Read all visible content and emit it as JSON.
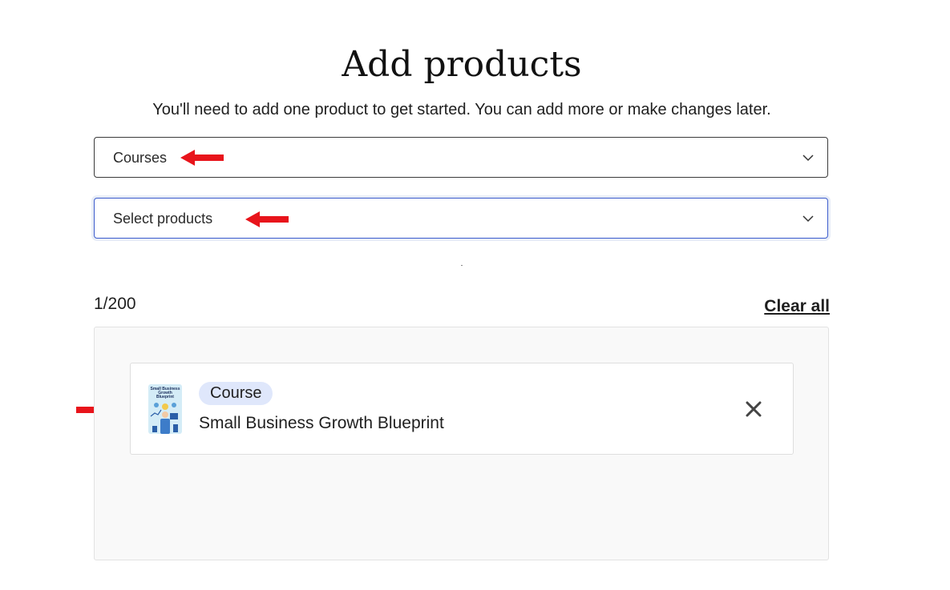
{
  "header": {
    "title": "Add products",
    "subtitle": "You'll need to add one product to get started. You can add more or make changes later."
  },
  "category_select": {
    "value": "Courses"
  },
  "product_select": {
    "placeholder": "Select products"
  },
  "selection": {
    "count": "1/200",
    "clear_all_label": "Clear all"
  },
  "selected_products": [
    {
      "type_badge": "Course",
      "name": "Small Business Growth Blueprint",
      "thumbnail_text": "Small Business Growth Blueprint"
    }
  ],
  "colors": {
    "annotation_arrow": "#e8141b",
    "focus_border": "#3b5bcc",
    "badge_bg": "#dfe7fb",
    "panel_bg": "#f9f9f9"
  }
}
